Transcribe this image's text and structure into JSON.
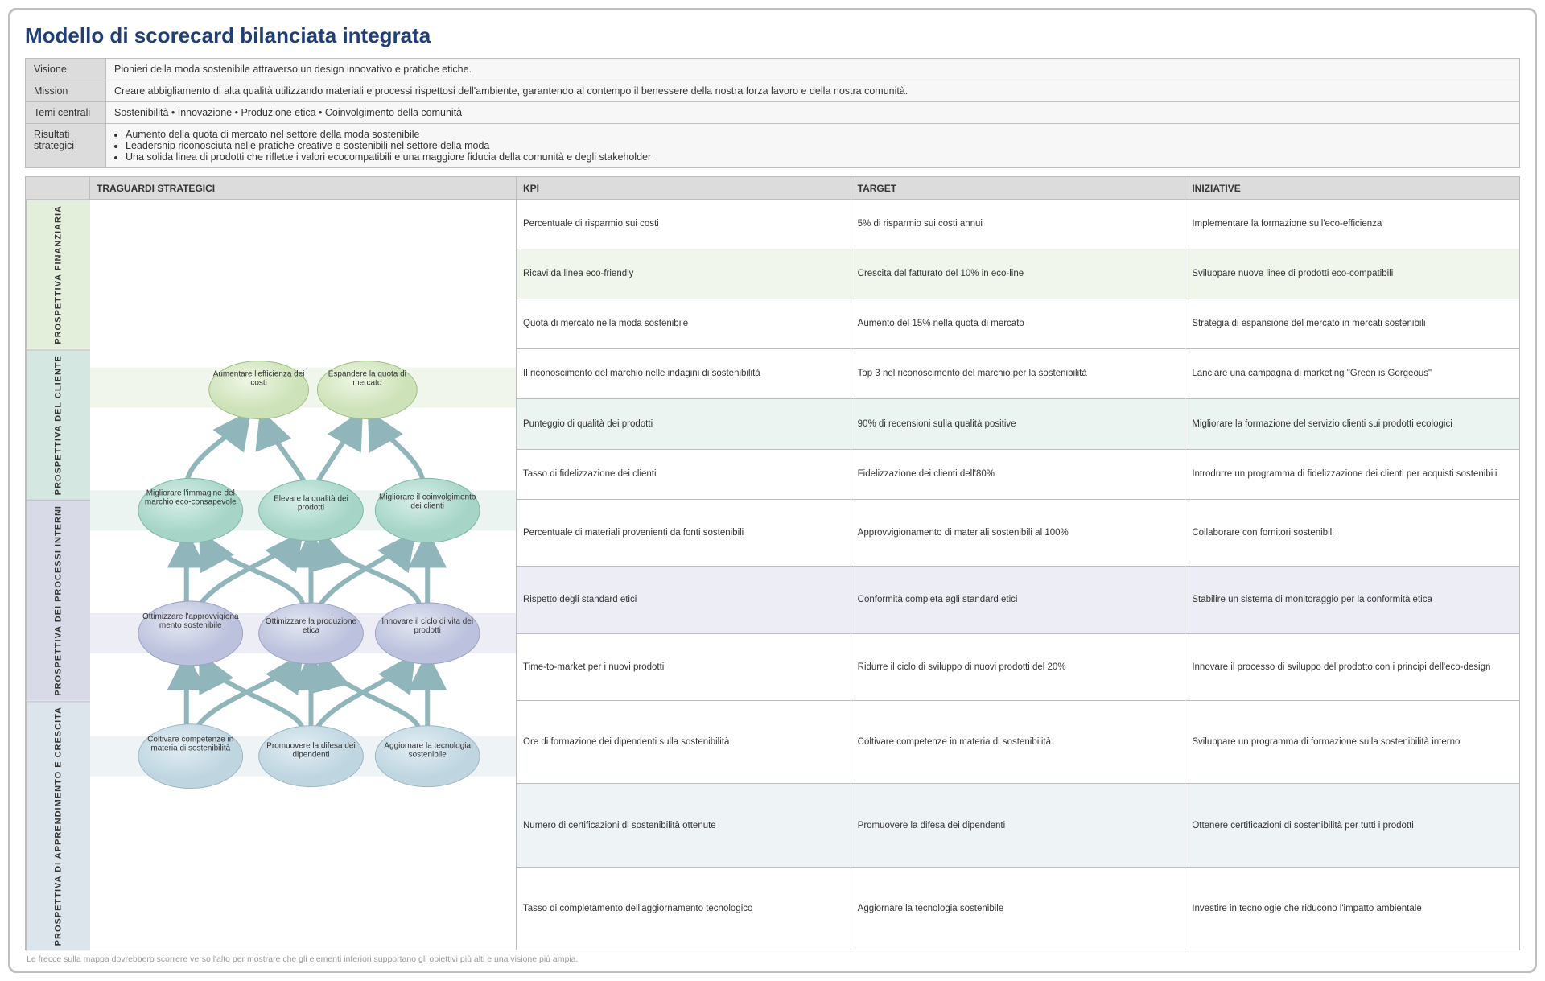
{
  "title": "Modello di scorecard bilanciata integrata",
  "meta": {
    "vision_label": "Visione",
    "vision": "Pionieri della moda sostenibile attraverso un design innovativo e pratiche etiche.",
    "mission_label": "Mission",
    "mission": "Creare abbigliamento di alta qualità utilizzando materiali e processi rispettosi dell'ambiente, garantendo al contempo il benessere della nostra forza lavoro e della nostra comunità.",
    "themes_label": "Temi centrali",
    "themes": "Sostenibilità  •  Innovazione  •  Produzione etica  •  Coinvolgimento della comunità",
    "outcomes_label": "Risultati strategici",
    "outcome1": "Aumento della quota di mercato nel settore della moda sostenibile",
    "outcome2": "Leadership riconosciuta nelle pratiche creative e sostenibili nel settore della moda",
    "outcome3": "Una solida linea di prodotti che riflette i valori ecocompatibili e una maggiore fiducia della comunità e degli stakeholder"
  },
  "headers": {
    "objectives": "TRAGUARDI STRATEGICI",
    "kpi": "KPI",
    "target": "TARGET",
    "initiatives": "INIZIATIVE"
  },
  "perspectives": {
    "fin": "PROSPETTIVA FINANZIARIA",
    "cli": "PROSPETTIVA DEL CLIENTE",
    "int": "PROSPETTIVA DEI PROCESSI INTERNI",
    "gro": "PROSPETTIVA DI APPRENDIMENTO E CRESCITA"
  },
  "objectives": {
    "fin1": "Aumentare l'efficienza dei costi",
    "fin2": "Espandere la quota di mercato",
    "cli1": "Migliorare l'immagine del marchio eco-consapevole",
    "cli2": "Elevare la qualità dei prodotti",
    "cli3": "Migliorare il coinvolgimento dei clienti",
    "int1": "Ottimizzare l'approvvigiona mento sostenibile",
    "int2": "Ottimizzare la produzione etica",
    "int3": "Innovare il ciclo di vita dei prodotti",
    "gro1": "Coltivare competenze in materia di sostenibilità",
    "gro2": "Promuovere la difesa dei dipendenti",
    "gro3": "Aggiornare la tecnologia sostenibile"
  },
  "rows": {
    "fin": [
      {
        "kpi": "Percentuale di risparmio sui costi",
        "target": "5% di risparmio sui costi annui",
        "init": "Implementare la formazione sull'eco-efficienza"
      },
      {
        "kpi": "Ricavi da linea eco-friendly",
        "target": "Crescita del fatturato del 10% in eco-line",
        "init": "Sviluppare nuove linee di prodotti eco-compatibili"
      },
      {
        "kpi": "Quota di mercato nella moda sostenibile",
        "target": "Aumento del 15% nella quota di mercato",
        "init": "Strategia di espansione del mercato in mercati sostenibili"
      }
    ],
    "cli": [
      {
        "kpi": "Il riconoscimento del marchio nelle indagini di sostenibilità",
        "target": "Top 3 nel riconoscimento del marchio per la sostenibilità",
        "init": "Lanciare una campagna di marketing \"Green is Gorgeous\""
      },
      {
        "kpi": "Punteggio di qualità dei prodotti",
        "target": "90% di recensioni sulla qualità positive",
        "init": "Migliorare la formazione del servizio clienti sui prodotti ecologici"
      },
      {
        "kpi": "Tasso di fidelizzazione dei clienti",
        "target": "Fidelizzazione dei clienti dell'80%",
        "init": "Introdurre un programma di fidelizzazione dei clienti per acquisti sostenibili"
      }
    ],
    "int": [
      {
        "kpi": "Percentuale di materiali provenienti da fonti sostenibili",
        "target": "Approvvigionamento di materiali sostenibili al 100%",
        "init": "Collaborare con fornitori sostenibili"
      },
      {
        "kpi": "Rispetto degli standard etici",
        "target": "Conformità completa agli standard etici",
        "init": "Stabilire un sistema di monitoraggio per la conformità etica"
      },
      {
        "kpi": "Time-to-market per i nuovi prodotti",
        "target": "Ridurre il ciclo di sviluppo di nuovi prodotti del 20%",
        "init": "Innovare il processo di sviluppo del prodotto con i principi dell'eco-design"
      }
    ],
    "gro": [
      {
        "kpi": "Ore di formazione dei dipendenti sulla sostenibilità",
        "target": "Coltivare competenze in materia di sostenibilità",
        "init": "Sviluppare un programma di formazione sulla sostenibilità interno"
      },
      {
        "kpi": "Numero di certificazioni di sostenibilità ottenute",
        "target": "Promuovere la difesa dei dipendenti",
        "init": "Ottenere certificazioni di sostenibilità per tutti i prodotti"
      },
      {
        "kpi": "Tasso di completamento dell'aggiornamento tecnologico",
        "target": "Aggiornare la tecnologia sostenibile",
        "init": "Investire in tecnologie che riducono l'impatto ambientale"
      }
    ]
  },
  "footnote": "Le frecce sulla mappa dovrebbero scorrere verso l'alto per mostrare che gli elementi inferiori supportano gli obiettivi più alti e una visione più ampia."
}
